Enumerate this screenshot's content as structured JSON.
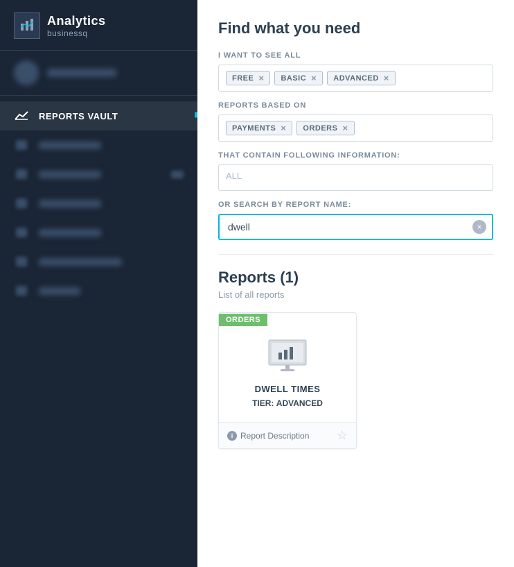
{
  "sidebar": {
    "app": {
      "title": "Analytics",
      "subtitle": "businessq"
    },
    "items": [
      {
        "id": "reports-vault",
        "label": "REPORTS VAULT",
        "active": true,
        "icon": "chart-icon"
      },
      {
        "id": "item2",
        "label": "",
        "active": false,
        "icon": "item2-icon"
      },
      {
        "id": "item3",
        "label": "",
        "active": false,
        "icon": "item3-icon"
      },
      {
        "id": "item4",
        "label": "",
        "active": false,
        "icon": "item4-icon"
      },
      {
        "id": "item5",
        "label": "",
        "active": false,
        "icon": "item5-icon"
      },
      {
        "id": "item6",
        "label": "",
        "active": false,
        "icon": "item6-icon"
      },
      {
        "id": "item7",
        "label": "",
        "active": false,
        "icon": "item7-icon"
      }
    ]
  },
  "main": {
    "find_title": "Find what you need",
    "filters": {
      "tier_label": "I WANT TO SEE ALL",
      "tier_tags": [
        {
          "id": "free",
          "label": "FREE"
        },
        {
          "id": "basic",
          "label": "BASIC"
        },
        {
          "id": "advanced",
          "label": "ADVANCED"
        }
      ],
      "based_on_label": "REPORTS BASED ON",
      "based_on_tags": [
        {
          "id": "payments",
          "label": "PAYMENTS"
        },
        {
          "id": "orders",
          "label": "ORDERS"
        }
      ],
      "info_label": "THAT CONTAIN FOLLOWING INFORMATION:",
      "info_placeholder": "ALL",
      "search_label": "OR SEARCH BY REPORT NAME:",
      "search_value": "dwell",
      "search_clear": "×"
    },
    "results": {
      "title": "Reports (1)",
      "subtitle": "List of all reports",
      "cards": [
        {
          "badge": "ORDERS",
          "name": "DWELL TIMES",
          "tier_label": "TIER:",
          "tier_value": "ADVANCED",
          "desc_link": "Report Description"
        }
      ]
    }
  }
}
